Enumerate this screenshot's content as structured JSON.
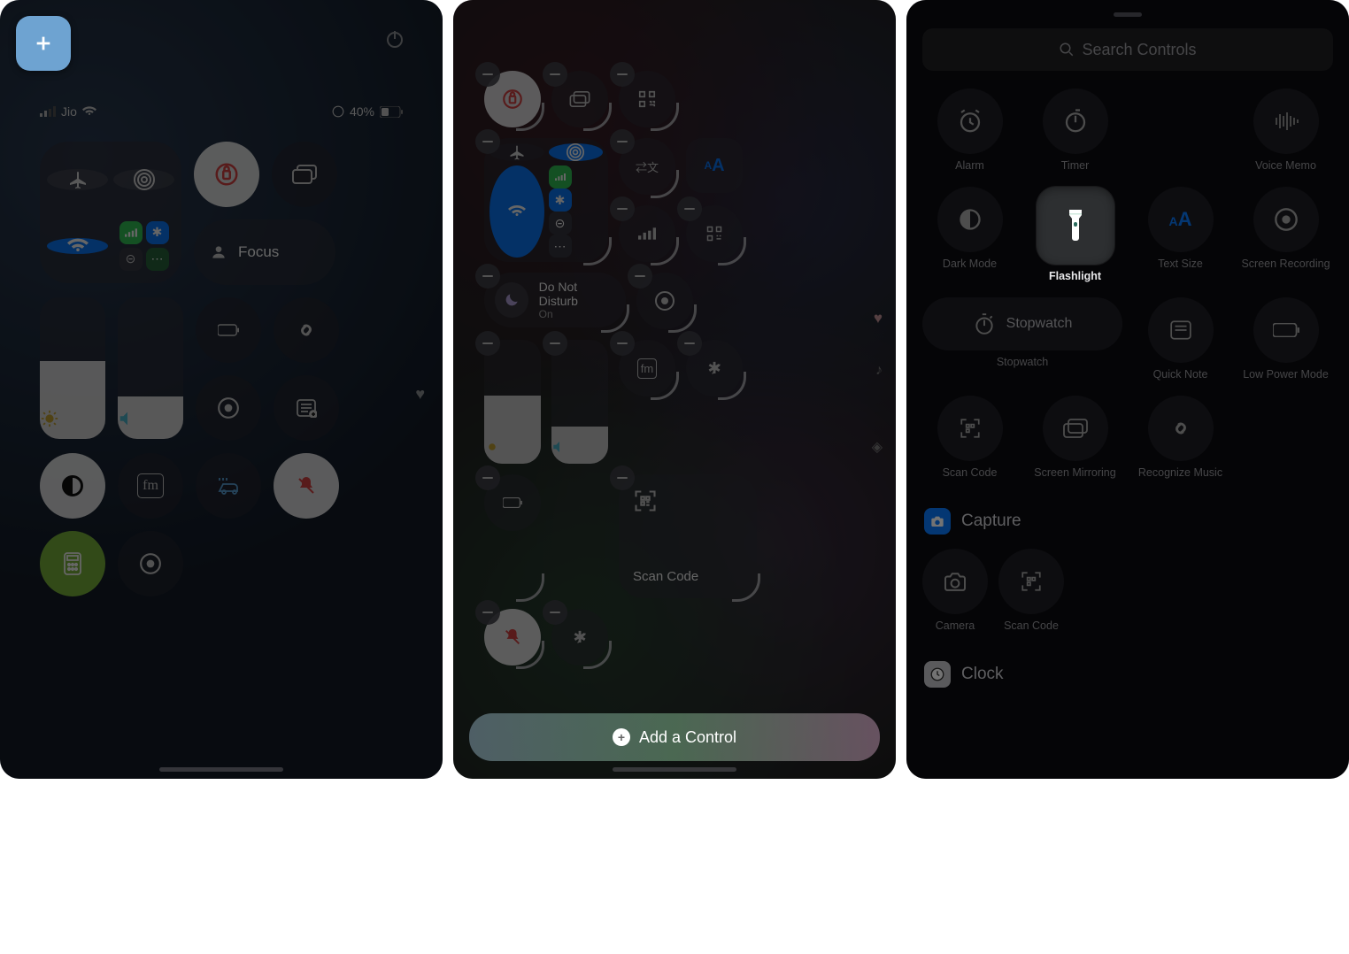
{
  "status": {
    "carrier": "Jio",
    "battery_pct": "40%"
  },
  "p1": {
    "focus_label": "Focus"
  },
  "p2": {
    "dnd_title": "Do Not Disturb",
    "dnd_sub": "On",
    "scan_label": "Scan Code",
    "add_control": "Add a Control"
  },
  "p3": {
    "search_placeholder": "Search Controls",
    "tiles": {
      "alarm": "Alarm",
      "timer": "Timer",
      "voice_memo": "Voice Memo",
      "dark_mode": "Dark Mode",
      "flashlight": "Flashlight",
      "text_size": "Text Size",
      "screen_rec": "Screen Recording",
      "stopwatch": "Stopwatch",
      "quick_note": "Quick Note",
      "low_power": "Low Power Mode",
      "scan_code": "Scan Code",
      "screen_mirror": "Screen Mirroring",
      "recognize": "Recognize Music",
      "camera": "Camera"
    },
    "sections": {
      "capture": "Capture",
      "clock": "Clock"
    }
  }
}
